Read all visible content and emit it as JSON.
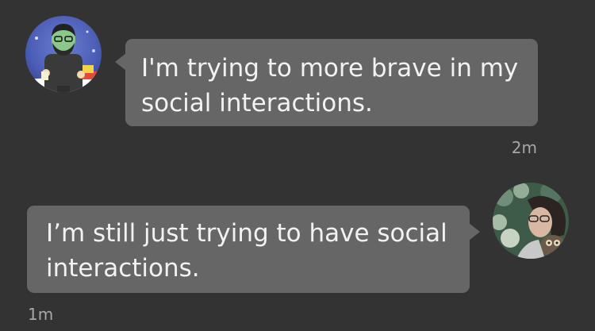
{
  "messages": [
    {
      "sender": "other",
      "avatar_icon": "cartoon-man-avatar-icon",
      "text": "I'm trying to more brave in my social interactions.",
      "time": "2m"
    },
    {
      "sender": "self",
      "avatar_icon": "woman-with-owl-avatar-icon",
      "text": "I’m still just trying to have social interactions.",
      "time": "1m"
    }
  ],
  "colors": {
    "background": "#333333",
    "bubble": "#666666",
    "text": "#f2f2f2",
    "timestamp": "#a8a8a8"
  }
}
